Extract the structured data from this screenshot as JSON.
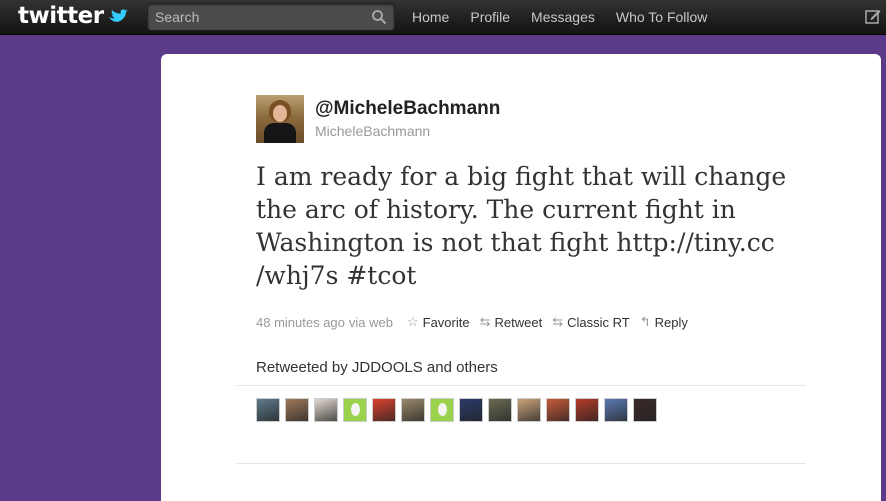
{
  "topbar": {
    "logo_text": "twitter",
    "search_placeholder": "Search",
    "nav": [
      "Home",
      "Profile",
      "Messages",
      "Who To Follow"
    ]
  },
  "tweet": {
    "handle": "@MicheleBachmann",
    "screen_name": "MicheleBachmann",
    "text": "I am ready for a big fight that will change the arc of history. The current fight in Washington is not that fight http://tiny.cc /whj7s #tcot",
    "timestamp": "48 minutes ago",
    "source": "via web",
    "actions": {
      "favorite": "Favorite",
      "retweet": "Retweet",
      "classic_rt": "Classic RT",
      "reply": "Reply"
    },
    "retweeted_by": "Retweeted by JDDOOLS and others"
  },
  "retweeter_avatars": [
    {
      "name": "avatar-1",
      "color": "#5f7a8c"
    },
    {
      "name": "avatar-2",
      "color": "#a07a5a"
    },
    {
      "name": "avatar-3",
      "color": "#e0d8cf"
    },
    {
      "name": "avatar-4-egg",
      "color": "#9bd24c"
    },
    {
      "name": "avatar-5",
      "color": "#d9422f"
    },
    {
      "name": "avatar-6",
      "color": "#9a8a6a"
    },
    {
      "name": "avatar-7-egg",
      "color": "#9bd24c"
    },
    {
      "name": "avatar-8",
      "color": "#2b3a6a"
    },
    {
      "name": "avatar-9",
      "color": "#6b6b55"
    },
    {
      "name": "avatar-10",
      "color": "#c9a27a"
    },
    {
      "name": "avatar-11",
      "color": "#c75a3a"
    },
    {
      "name": "avatar-12",
      "color": "#b33a2a"
    },
    {
      "name": "avatar-13",
      "color": "#5a7ab0"
    },
    {
      "name": "avatar-14",
      "color": "#3a2a2a"
    }
  ],
  "colors": {
    "background": "#5b3a8a",
    "topbar": "#1f1f1f",
    "twitter_blue": "#33ccff"
  }
}
